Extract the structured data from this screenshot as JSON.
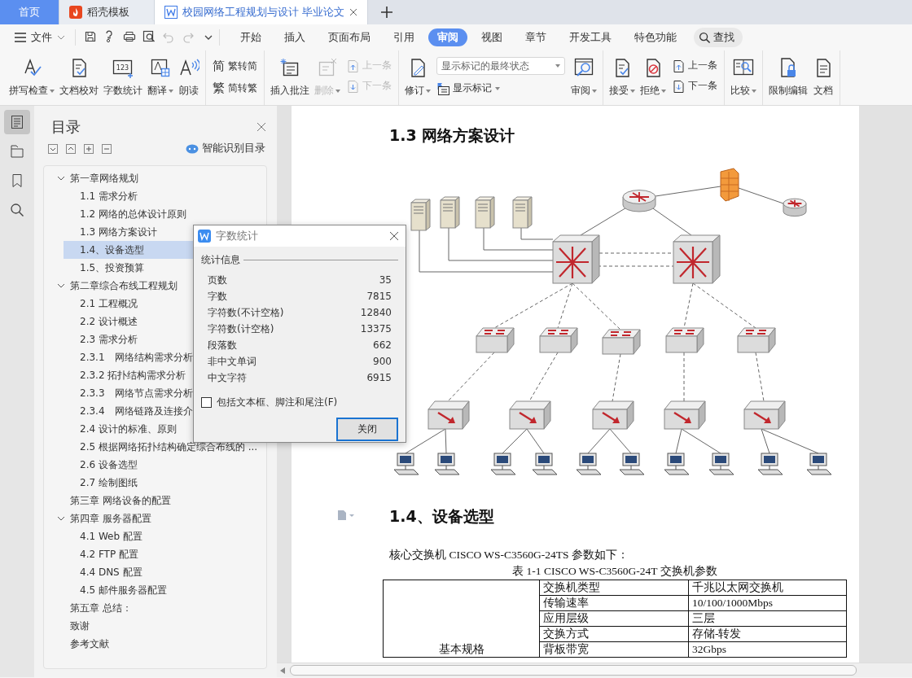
{
  "tabs": [
    {
      "label": "首页",
      "kind": "home",
      "selected": false
    },
    {
      "label": "稻壳模板",
      "kind": "template",
      "selected": false
    },
    {
      "label": "校园网络工程规划与设计 毕业论文",
      "kind": "document",
      "selected": true
    }
  ],
  "quick_tools": [
    {
      "disabled": false
    },
    {
      "disabled": false
    },
    {
      "disabled": false
    },
    {
      "disabled": false
    },
    {
      "disabled": true
    },
    {
      "disabled": true
    }
  ],
  "menu": {
    "file": "文件",
    "search": "查找",
    "tabs": [
      {
        "label": "开始",
        "selected": false
      },
      {
        "label": "插入",
        "selected": false
      },
      {
        "label": "页面布局",
        "selected": false
      },
      {
        "label": "引用",
        "selected": false
      },
      {
        "label": "审阅",
        "selected": true
      },
      {
        "label": "视图",
        "selected": false
      },
      {
        "label": "章节",
        "selected": false
      },
      {
        "label": "开发工具",
        "selected": false
      },
      {
        "label": "特色功能",
        "selected": false
      }
    ]
  },
  "ribbon": [
    {
      "items": [
        {
          "kind": "large",
          "label": "拼写检查",
          "dropdown": true,
          "disabled": false
        },
        {
          "kind": "large",
          "label": "文档校对",
          "dropdown": false,
          "disabled": false
        },
        {
          "kind": "large",
          "label": "字数统计",
          "dropdown": false,
          "disabled": false,
          "icon_text": "123"
        },
        {
          "kind": "large",
          "label": "翻译",
          "dropdown": true,
          "disabled": false
        },
        {
          "kind": "large",
          "label": "朗读",
          "dropdown": false,
          "disabled": false
        }
      ]
    },
    {
      "items": [
        {
          "kind": "stack",
          "rows": [
            {
              "glyph": "简",
              "label": "繁转简",
              "disabled": false
            },
            {
              "glyph": "繁",
              "label": "简转繁",
              "disabled": false
            }
          ]
        }
      ]
    },
    {
      "items": [
        {
          "kind": "large",
          "label": "插入批注",
          "dropdown": false,
          "disabled": false
        },
        {
          "kind": "large",
          "label": "删除",
          "dropdown": true,
          "disabled": true
        },
        {
          "kind": "stack",
          "rows": [
            {
              "label": "上一条",
              "disabled": true
            },
            {
              "label": "下一条",
              "disabled": true
            }
          ]
        }
      ]
    },
    {
      "items": [
        {
          "kind": "large",
          "label": "修订",
          "dropdown": true,
          "disabled": false
        },
        {
          "kind": "select",
          "value": "显示标记的最终状态",
          "label": "显示标记",
          "dropdown": true
        },
        {
          "kind": "large",
          "label": "审阅",
          "dropdown": true,
          "disabled": false
        }
      ]
    },
    {
      "items": [
        {
          "kind": "large",
          "label": "接受",
          "dropdown": true,
          "disabled": false
        },
        {
          "kind": "large",
          "label": "拒绝",
          "dropdown": true,
          "disabled": false
        },
        {
          "kind": "stack",
          "rows": [
            {
              "label": "上一条",
              "disabled": false
            },
            {
              "label": "下一条",
              "disabled": false
            }
          ]
        }
      ]
    },
    {
      "items": [
        {
          "kind": "large",
          "label": "比较",
          "dropdown": true,
          "disabled": false
        }
      ]
    },
    {
      "items": [
        {
          "kind": "large",
          "label": "限制编辑",
          "dropdown": false,
          "disabled": false
        },
        {
          "kind": "large",
          "label": "文档",
          "dropdown": false,
          "disabled": false
        }
      ]
    }
  ],
  "rail": [
    {
      "selected": true
    },
    {
      "selected": false
    },
    {
      "selected": false
    },
    {
      "selected": false
    }
  ],
  "toc": {
    "title": "目录",
    "smart": "智能识别目录",
    "items": [
      {
        "label": "第一章网络规划",
        "selected": false,
        "expanded": true,
        "children": [
          {
            "label": "1.1 需求分析",
            "selected": false
          },
          {
            "label": "1.2 网络的总体设计原则",
            "selected": false
          },
          {
            "label": "1.3 网络方案设计",
            "selected": false
          },
          {
            "label": "1.4、设备选型",
            "selected": true
          },
          {
            "label": "1.5、投资预算",
            "selected": false
          }
        ]
      },
      {
        "label": "第二章综合布线工程规划",
        "selected": false,
        "expanded": true,
        "children": [
          {
            "label": "2.1 工程概况",
            "selected": false
          },
          {
            "label": "2.2 设计概述",
            "selected": false
          },
          {
            "label": "2.3 需求分析",
            "selected": false
          },
          {
            "label": "2.3.1　网络结构需求分析",
            "selected": false
          },
          {
            "label": "2.3.2  拓扑结构需求分析",
            "selected": false
          },
          {
            "label": "2.3.3　网络节点需求分析",
            "selected": false
          },
          {
            "label": "2.3.4　网络链路及连接介",
            "selected": false
          },
          {
            "label": "2.4 设计的标准、原则",
            "selected": false
          },
          {
            "label": "2.5 根据网络拓扑结构确定综合布线的 ...",
            "selected": false
          },
          {
            "label": "2.6  设备选型",
            "selected": false
          },
          {
            "label": "2.7  绘制图纸",
            "selected": false
          }
        ]
      },
      {
        "label": "第三章  网络设备的配置",
        "selected": false
      },
      {
        "label": "第四章  服务器配置",
        "selected": false,
        "expanded": true,
        "children": [
          {
            "label": "4.1 Web 配置",
            "selected": false
          },
          {
            "label": "4.2 FTP 配置",
            "selected": false
          },
          {
            "label": "4.4 DNS 配置",
            "selected": false
          },
          {
            "label": "4.5 邮件服务器配置",
            "selected": false
          }
        ]
      },
      {
        "label": "第五章  总结：",
        "selected": false
      },
      {
        "label": "致谢",
        "selected": false
      },
      {
        "label": "参考文献",
        "selected": false
      }
    ]
  },
  "dialog": {
    "title": "字数统计",
    "group": "统计信息",
    "stats": [
      {
        "label": "页数",
        "value": "35"
      },
      {
        "label": "字数",
        "value": "7815"
      },
      {
        "label": "字符数(不计空格)",
        "value": "12840"
      },
      {
        "label": "字符数(计空格)",
        "value": "13375"
      },
      {
        "label": "段落数",
        "value": "662"
      },
      {
        "label": "非中文单词",
        "value": "900"
      },
      {
        "label": "中文字符",
        "value": "6915"
      }
    ],
    "option": {
      "label": "包括文本框、脚注和尾注(F)",
      "checked": false
    },
    "button": "关闭"
  },
  "document": {
    "heading_1": "1.3 网络方案设计",
    "heading_2": "1.4、设备选型",
    "intro": "核心交换机 CISCO WS-C3560G-24TS 参数如下：",
    "caption": "表 1-1 CISCO WS-C3560G-24T 交换机参数",
    "table": {
      "group": "基本规格",
      "rows": [
        [
          "交换机类型",
          "千兆以太网交换机"
        ],
        [
          "传输速率",
          "10/100/1000Mbps"
        ],
        [
          "应用层级",
          "三层"
        ],
        [
          "交换方式",
          "存储-转发"
        ],
        [
          "背板带宽",
          "32Gbps"
        ]
      ]
    }
  }
}
